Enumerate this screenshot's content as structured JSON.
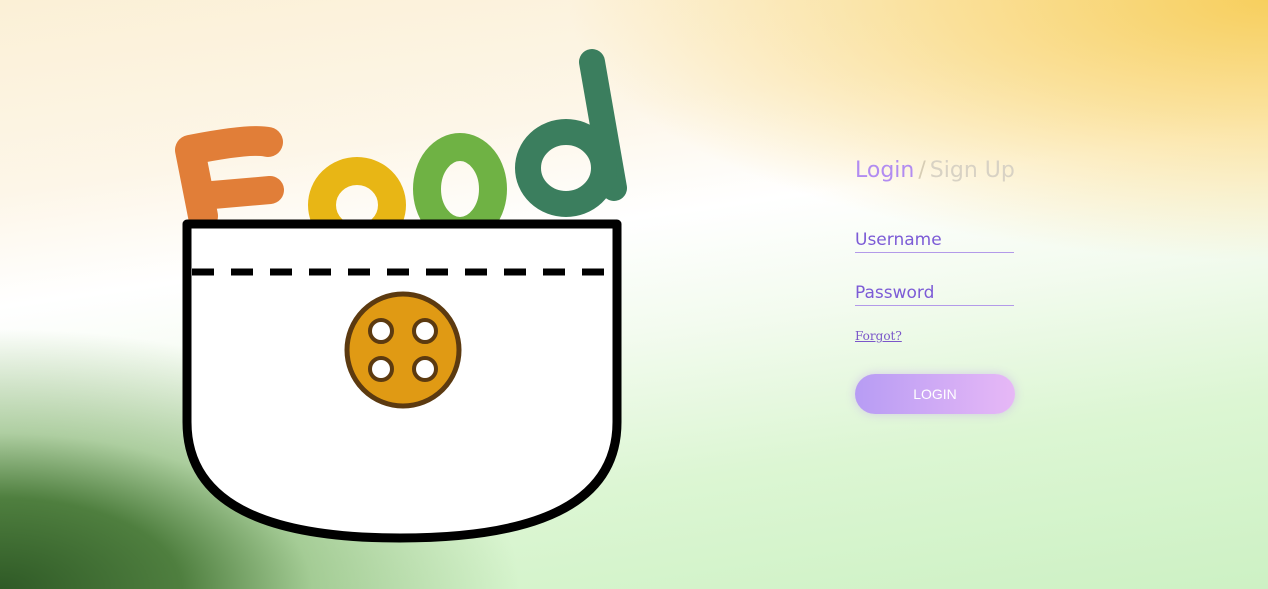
{
  "brand": {
    "logo_text": "Food"
  },
  "auth": {
    "tab_login": "Login",
    "tab_separator": "/",
    "tab_signup": "Sign Up",
    "username_placeholder": "Username",
    "password_placeholder": "Password",
    "forgot_label": "Forgot?",
    "login_button": "LOGIN"
  },
  "colors": {
    "accent_purple": "#b28cf1",
    "letter_F": "#e17e38",
    "letter_o1": "#e8b615",
    "letter_o2": "#6fb244",
    "letter_d": "#3b7e5e",
    "button_gold": "#e09a14"
  },
  "icons": {
    "logo": "pocket-with-button-icon"
  }
}
